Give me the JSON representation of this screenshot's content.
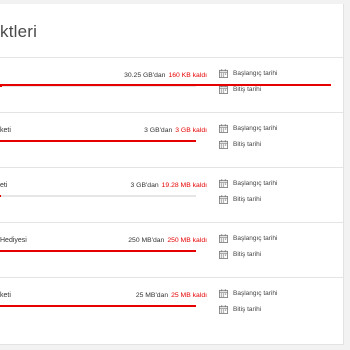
{
  "page": {
    "title": "ktleri"
  },
  "packages": [
    {
      "name": "",
      "total": "30.25 GB'dan",
      "remaining": "160 KB kaldı",
      "remaining_fraction": 0.01,
      "start_label": "Başlangıç tarihi",
      "end_label": "Bitiş tarihi"
    },
    {
      "name": "keti",
      "total": "3 GB'dan",
      "remaining": "3 GB kaldı",
      "remaining_fraction": 1.0,
      "start_label": "Başlangıç tarihi",
      "end_label": "Bitiş tarihi"
    },
    {
      "name": "eti",
      "total": "3 GB'dan",
      "remaining": "19.28 MB kaldı",
      "remaining_fraction": 0.006,
      "start_label": "Başlangıç tarihi",
      "end_label": "Bitiş tarihi"
    },
    {
      "name": "Hediyesi",
      "total": "250 MB'dan",
      "remaining": "250 MB kaldı",
      "remaining_fraction": 1.0,
      "start_label": "Başlangıç tarihi",
      "end_label": "Bitiş tarihi"
    },
    {
      "name": "keti",
      "total": "25 MB'dan",
      "remaining": "25 MB kaldı",
      "remaining_fraction": 1.0,
      "start_label": "Başlangıç tarihi",
      "end_label": "Bitiş tarihi"
    }
  ],
  "colors": {
    "accent": "#e60000",
    "track": "#e6e6e6"
  },
  "icons": {
    "date": "calendar-icon"
  }
}
